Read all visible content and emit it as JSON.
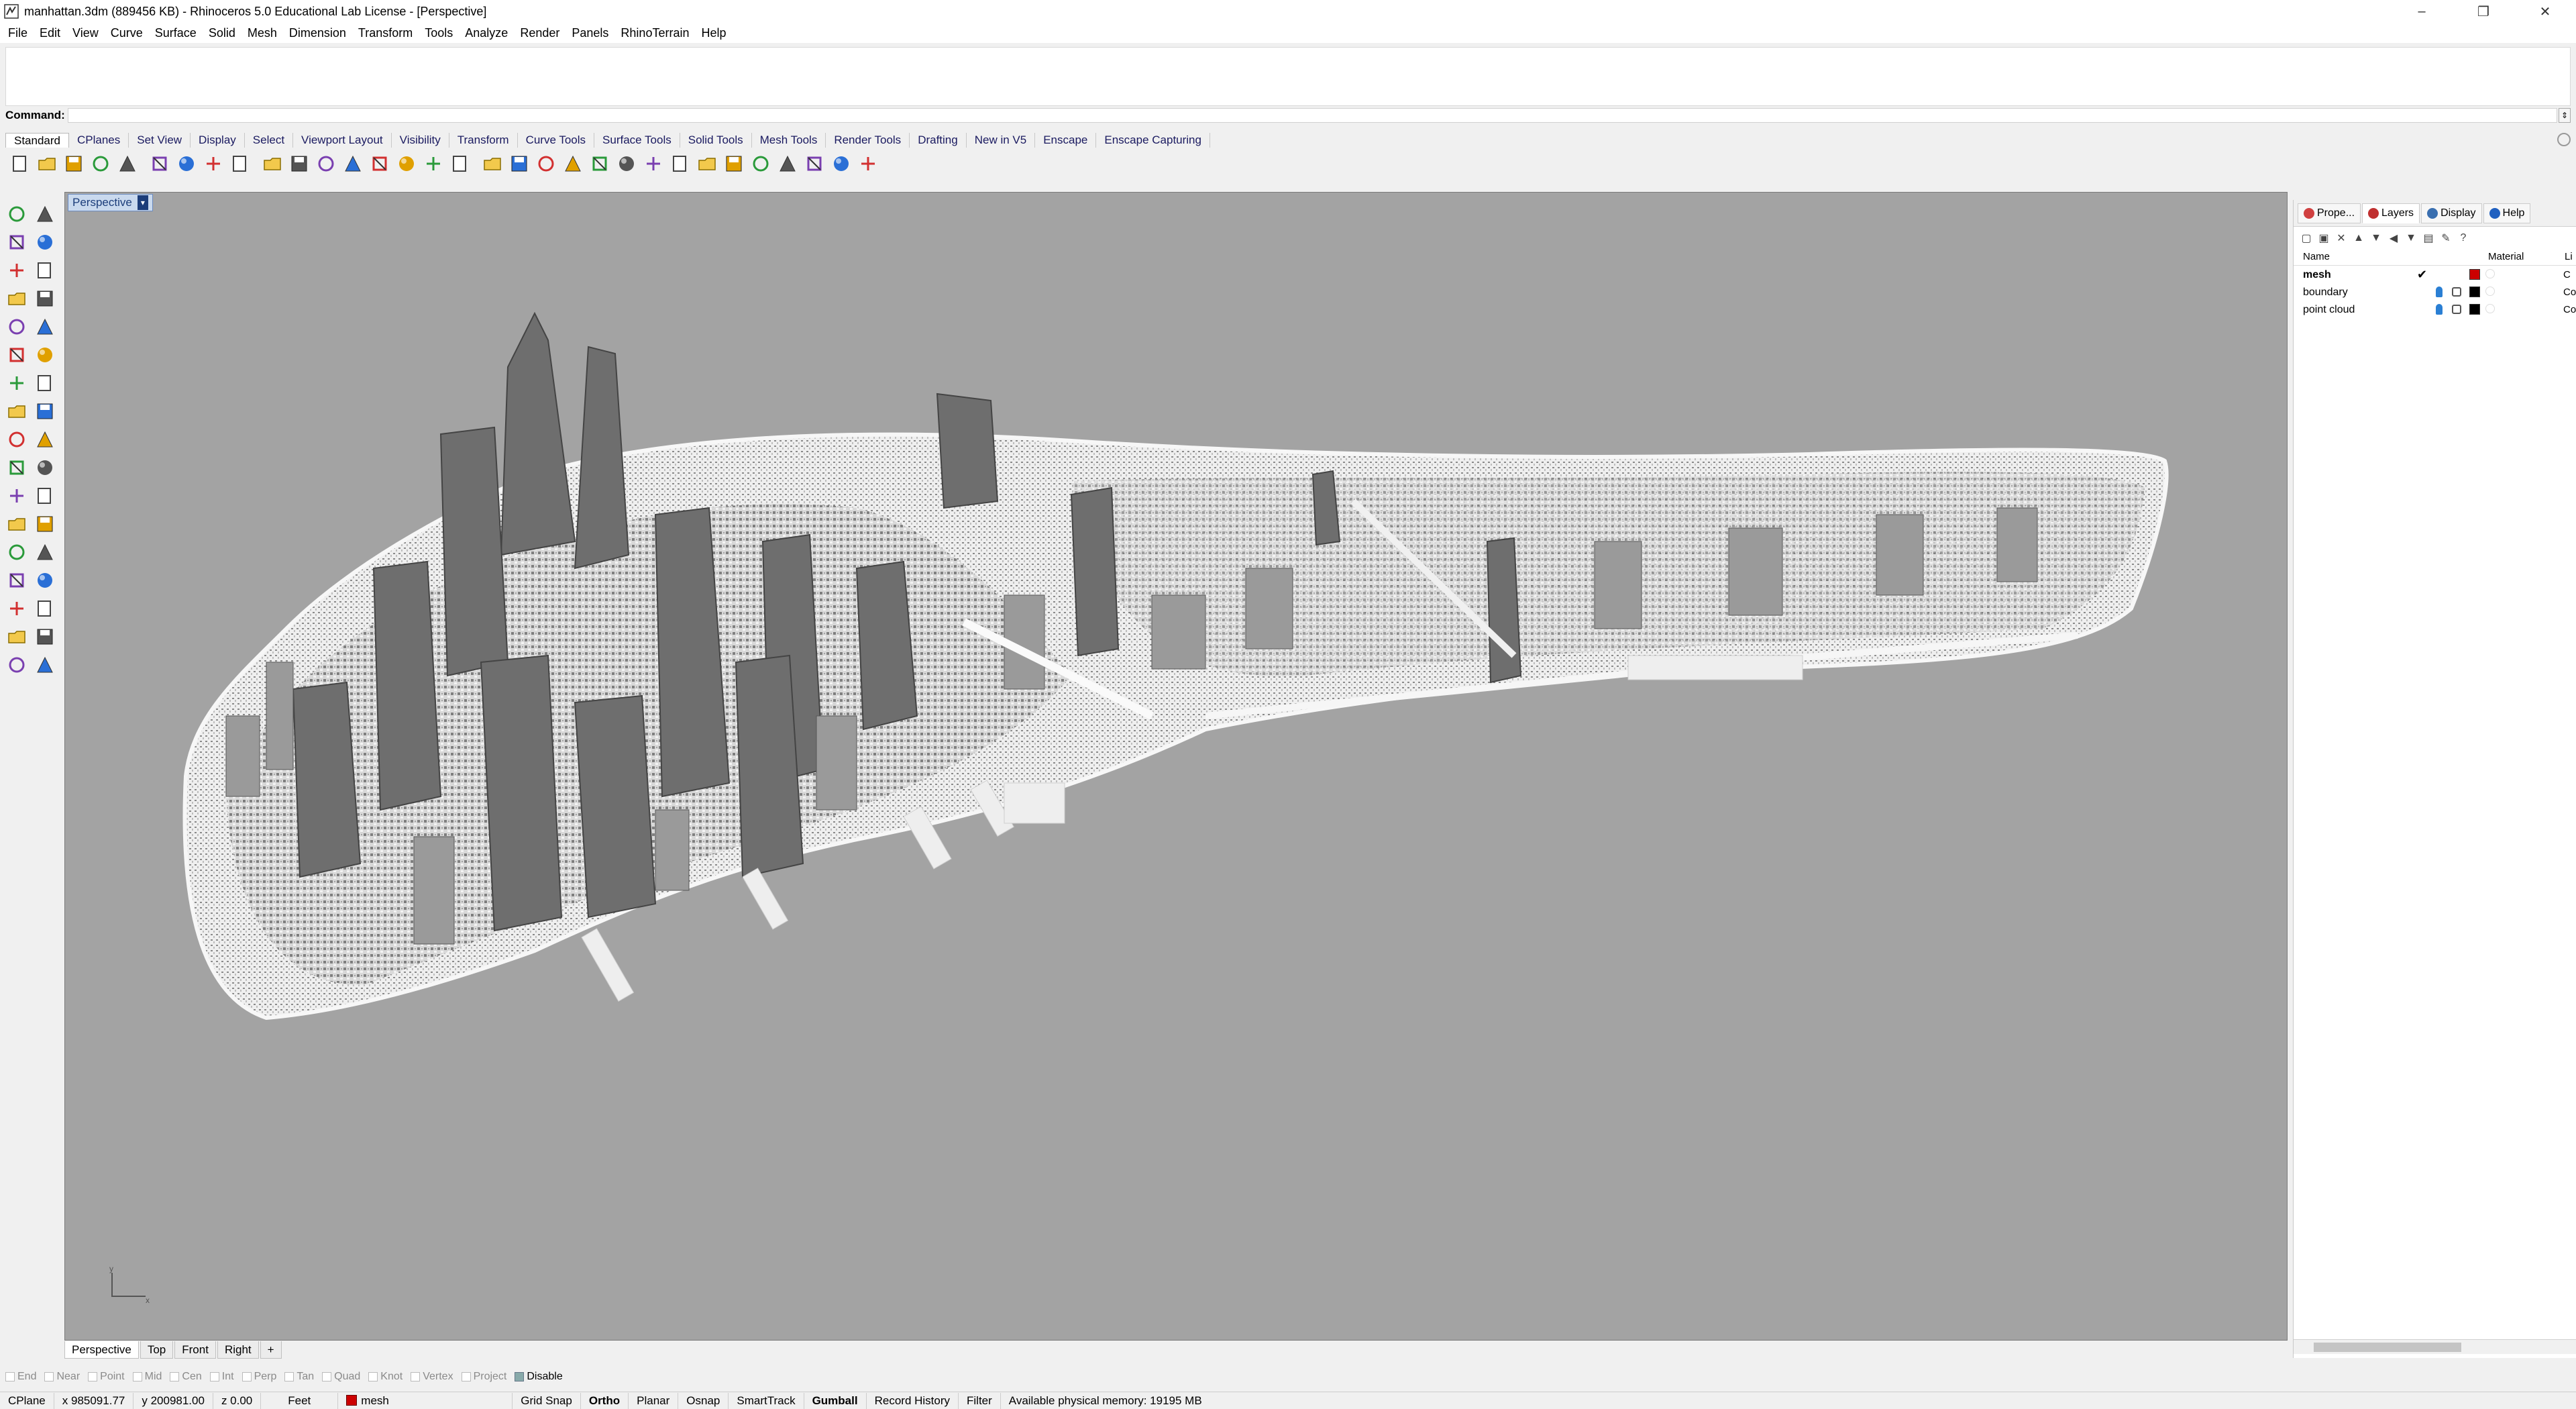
{
  "window": {
    "title": "manhattan.3dm (889456 KB) - Rhinoceros 5.0 Educational Lab License - [Perspective]",
    "controls": [
      "–",
      "❐",
      "✕"
    ]
  },
  "menu": [
    "File",
    "Edit",
    "View",
    "Curve",
    "Surface",
    "Solid",
    "Mesh",
    "Dimension",
    "Transform",
    "Tools",
    "Analyze",
    "Render",
    "Panels",
    "RhinoTerrain",
    "Help"
  ],
  "command": {
    "label": "Command:",
    "value": ""
  },
  "toolbar_tabs": [
    "Standard",
    "CPlanes",
    "Set View",
    "Display",
    "Select",
    "Viewport Layout",
    "Visibility",
    "Transform",
    "Curve Tools",
    "Surface Tools",
    "Solid Tools",
    "Mesh Tools",
    "Render Tools",
    "Drafting",
    "New in V5",
    "Enscape",
    "Enscape Capturing"
  ],
  "active_toolbar_tab": "Standard",
  "viewport": {
    "title": "Perspective",
    "dropdown": "▾",
    "background_color": "#a3a3a3"
  },
  "viewport_tabs": [
    "Perspective",
    "Top",
    "Front",
    "Right",
    "+"
  ],
  "osnaps": [
    {
      "label": "End",
      "checked": false
    },
    {
      "label": "Near",
      "checked": false
    },
    {
      "label": "Point",
      "checked": false
    },
    {
      "label": "Mid",
      "checked": false
    },
    {
      "label": "Cen",
      "checked": false
    },
    {
      "label": "Int",
      "checked": false
    },
    {
      "label": "Perp",
      "checked": false
    },
    {
      "label": "Tan",
      "checked": false
    },
    {
      "label": "Quad",
      "checked": false
    },
    {
      "label": "Knot",
      "checked": false
    },
    {
      "label": "Vertex",
      "checked": false
    },
    {
      "label": "Project",
      "checked": false
    },
    {
      "label": "Disable",
      "checked": true
    }
  ],
  "status": {
    "cplane": "CPlane",
    "x": "x 985091.77",
    "y": "y 200981.00",
    "z": "z 0.00",
    "units": "Feet",
    "layer": "mesh",
    "layer_color": "#cc0000",
    "grid_snap": "Grid Snap",
    "ortho": "Ortho",
    "planar": "Planar",
    "osnap": "Osnap",
    "smarttrack": "SmartTrack",
    "gumball": "Gumball",
    "record_history": "Record History",
    "filter": "Filter",
    "memory": "Available physical memory: 19195 MB"
  },
  "panel": {
    "tabs": [
      {
        "label": "Prope...",
        "color": "#d04040"
      },
      {
        "label": "Layers",
        "color": "#c03030"
      },
      {
        "label": "Display",
        "color": "#3a6fb0"
      },
      {
        "label": "Help",
        "color": "#2060c0"
      }
    ],
    "active_tab": "Layers",
    "columns": {
      "name": "Name",
      "material": "Material",
      "linetype": "Li"
    },
    "layers": [
      {
        "name": "mesh",
        "current": true,
        "color": "#cc0000",
        "linetype": "C"
      },
      {
        "name": "boundary",
        "current": false,
        "color": "#000000",
        "linetype": "Co"
      },
      {
        "name": "point cloud",
        "current": false,
        "color": "#000000",
        "linetype": "Co"
      }
    ]
  },
  "icons": {
    "standard_toolbar": [
      "new-icon",
      "open-icon",
      "save-icon",
      "print-icon",
      "import-icon",
      "cut-icon",
      "copy-icon",
      "paste-icon",
      "undo-icon",
      "pan-icon",
      "move-icon",
      "rotate-view-icon",
      "zoom-icon",
      "zoom-window-icon",
      "zoom-extents-icon",
      "zoom-selected-icon",
      "viewport-layout-icon",
      "rotate-icon",
      "car-icon",
      "wireframe-icon",
      "shaded-icon",
      "ghosted-icon",
      "light-icon",
      "lock-icon",
      "select-filter-icon",
      "color-wheel-icon",
      "material-sphere-icon",
      "render-sphere-icon",
      "environment-sphere-icon",
      "render-icon",
      "options-icon",
      "help-icon"
    ],
    "left_toolbar": [
      "select-arrow-icon",
      "point-icon",
      "polyline-icon",
      "curve-icon",
      "circle-icon",
      "ellipse-icon",
      "polygon-icon",
      "rectangle-icon",
      "arc-icon",
      "freeform-icon",
      "surface-icon",
      "loft-icon",
      "box-icon",
      "sphere-icon",
      "cylinder-icon",
      "extrude-icon",
      "mesh-icon",
      "explode-icon",
      "boolean-icon",
      "gumball-icon",
      "fillet-icon",
      "trim-icon",
      "split-icon",
      "join-icon",
      "group-icon",
      "ungroup-icon",
      "array-icon",
      "measure-icon",
      "dimension-icon",
      "text-icon",
      "analyze-icon",
      "render-icon",
      "layout-icon",
      "snap-icon"
    ]
  }
}
